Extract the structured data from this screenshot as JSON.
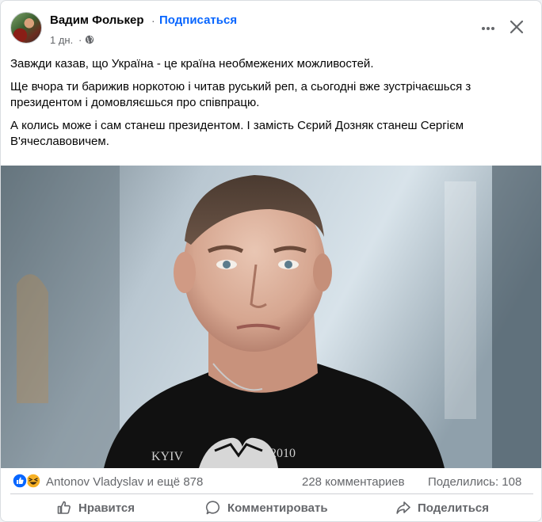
{
  "post": {
    "author": "Вадим Фолькер",
    "separator": "·",
    "subscribe_label": "Подписаться",
    "time": "1 дн.",
    "time_separator": "·",
    "paragraphs": [
      "Завжди казав, що Україна - це країна необмежених можливостей.",
      "Ще вчора ти барижив норкотою і читав руський реп, а сьогодні вже зустрічаєшься з президентом і домовляєшься про співпрацю.",
      "А колись може і сам станеш президентом. І замість Сєрий Дозняк станеш Сергієм В'ячеславовичем."
    ],
    "photo_shirt_text_left": "KYIV",
    "photo_shirt_text_right": "2010"
  },
  "stats": {
    "reactors": "Antonov Vladyslav и ещё 878",
    "comments": "228 комментариев",
    "shares": "Поделились: 108"
  },
  "actions": {
    "like": "Нравится",
    "comment": "Комментировать",
    "share": "Поделиться"
  },
  "colors": {
    "link_blue": "#0866ff",
    "secondary_text": "#65676b",
    "like_blue": "#0866ff",
    "haha_yellow": "#f7b125"
  },
  "icons": [
    "globe-icon",
    "more-icon",
    "close-icon",
    "like-reaction-icon",
    "haha-reaction-icon",
    "thumbs-up-icon",
    "comment-icon",
    "share-icon"
  ]
}
